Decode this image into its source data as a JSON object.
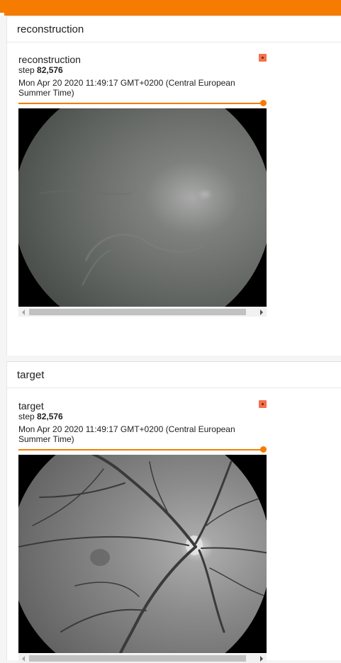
{
  "cards": [
    {
      "header": "reconstruction",
      "pane": {
        "title": "reconstruction",
        "step_label": "step",
        "step_value": "82,576",
        "timestamp": "Mon Apr 20 2020 11:49:17 GMT+0200 (Central European Summer Time)",
        "image_icon": "fundus-reconstruction-image",
        "slider_level": 1.0
      }
    },
    {
      "header": "target",
      "pane": {
        "title": "target",
        "step_label": "step",
        "step_value": "82,576",
        "timestamp": "Mon Apr 20 2020 11:49:17 GMT+0200 (Central European Summer Time)",
        "image_icon": "fundus-target-image",
        "slider_level": 1.0
      }
    }
  ],
  "colors": {
    "accent": "#f57c00",
    "expand_button": "#f4714b"
  }
}
